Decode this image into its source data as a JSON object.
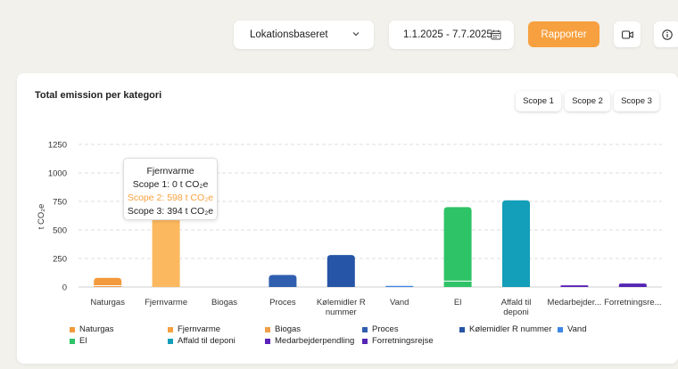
{
  "toolbar": {
    "dropdown_value": "Lokationsbaseret",
    "date_range": "1.1.2025 - 7.7.2025",
    "report_label": "Rapporter",
    "icons": [
      "chevron-down-icon",
      "calendar-icon",
      "video-icon",
      "info-icon"
    ]
  },
  "card": {
    "title": "Total emission per kategori",
    "scopes": [
      "Scope 1",
      "Scope 2",
      "Scope 3"
    ]
  },
  "tooltip": {
    "title": "Fjernvarme",
    "scope1": "Scope 1: 0 t CO₂e",
    "scope2": "Scope 2: 598 t CO₂e",
    "scope3": "Scope 3: 394 t CO₂e"
  },
  "colors": {
    "accent": "#f7a03f"
  },
  "chart_data": {
    "type": "bar",
    "stacked": true,
    "ylabel": "t CO₂e",
    "ylim": [
      0,
      1250
    ],
    "yticks": [
      0,
      250,
      500,
      750,
      1000,
      1250
    ],
    "grid": true,
    "categories": [
      "Naturgas",
      "Fjernvarme",
      "Biogas",
      "Proces",
      "Kølemidler R nummer",
      "Vand",
      "El",
      "Affald til deponi",
      "Medarbejderpendling",
      "Forretningsrejse"
    ],
    "tick_labels": [
      [
        "Naturgas"
      ],
      [
        "Fjernvarme"
      ],
      [
        "Biogas"
      ],
      [
        "Proces"
      ],
      [
        "Kølemidler R",
        "nummer"
      ],
      [
        "Vand"
      ],
      [
        "El"
      ],
      [
        "Affald til",
        "deponi"
      ],
      [
        "Medarbejder..."
      ],
      [
        "Forretningsre..."
      ]
    ],
    "colors": [
      "#f39a3c",
      "#f7a03f",
      "#f0a04a",
      "#2f5fae",
      "#2654a6",
      "#3d86e6",
      "#2ec366",
      "#139eb9",
      "#5b22b8",
      "#5424b4"
    ],
    "highlight_colors": [
      "#f6a94f",
      "#fcb85e",
      "#f0a04a",
      "#2f5fae",
      "#2654a6",
      "#3d86e6",
      "#2ec366",
      "#139eb9",
      "#5b22b8",
      "#5424b4"
    ],
    "series": [
      {
        "name": "Scope 1",
        "values": [
          12,
          0,
          0,
          0,
          0,
          0,
          0,
          0,
          0,
          0
        ]
      },
      {
        "name": "Scope 2",
        "values": [
          0,
          598,
          0,
          0,
          0,
          0,
          52,
          0,
          0,
          0
        ]
      },
      {
        "name": "Scope 3",
        "values": [
          68,
          394,
          0,
          105,
          280,
          10,
          648,
          760,
          15,
          30
        ]
      }
    ],
    "legend": [
      "Naturgas",
      "Fjernvarme",
      "Biogas",
      "Proces",
      "Kølemidler R nummer",
      "Vand",
      "El",
      "Affald til deponi",
      "Medarbejderpendling",
      "Forretningsrejse"
    ],
    "legend_placement": "bottom"
  }
}
